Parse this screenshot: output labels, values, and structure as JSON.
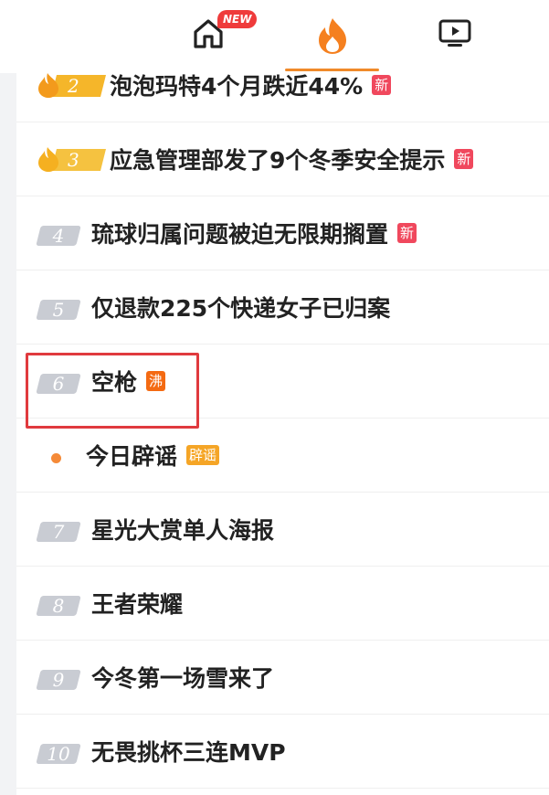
{
  "nav": {
    "home_badge": "NEW"
  },
  "list": {
    "rows": [
      {
        "rank": "2",
        "title": "泡泡玛特4个月跌近44%",
        "tag": "新"
      },
      {
        "rank": "3",
        "title": "应急管理部发了9个冬季安全提示",
        "tag": "新"
      },
      {
        "rank": "4",
        "title": "琉球归属问题被迫无限期搁置",
        "tag": "新"
      },
      {
        "rank": "5",
        "title": "仅退款225个快递女子已归案",
        "tag": ""
      },
      {
        "rank": "6",
        "title": "空枪",
        "tag": "沸"
      },
      {
        "rank": "",
        "title": "今日辟谣",
        "tag": "辟谣"
      },
      {
        "rank": "7",
        "title": "星光大赏单人海报",
        "tag": ""
      },
      {
        "rank": "8",
        "title": "王者荣耀",
        "tag": ""
      },
      {
        "rank": "9",
        "title": "今冬第一场雪来了",
        "tag": ""
      },
      {
        "rank": "10",
        "title": "无畏挑杯三连MVP",
        "tag": ""
      }
    ]
  },
  "colors": {
    "accent": "#f08a2a",
    "hot_rank": "#f5b62a",
    "rank_gray": "#c9ccd3",
    "tag_new": "#f0485d",
    "tag_boil": "#f46a12",
    "tag_rumor": "#f5a526",
    "highlight": "#e03a3e"
  }
}
